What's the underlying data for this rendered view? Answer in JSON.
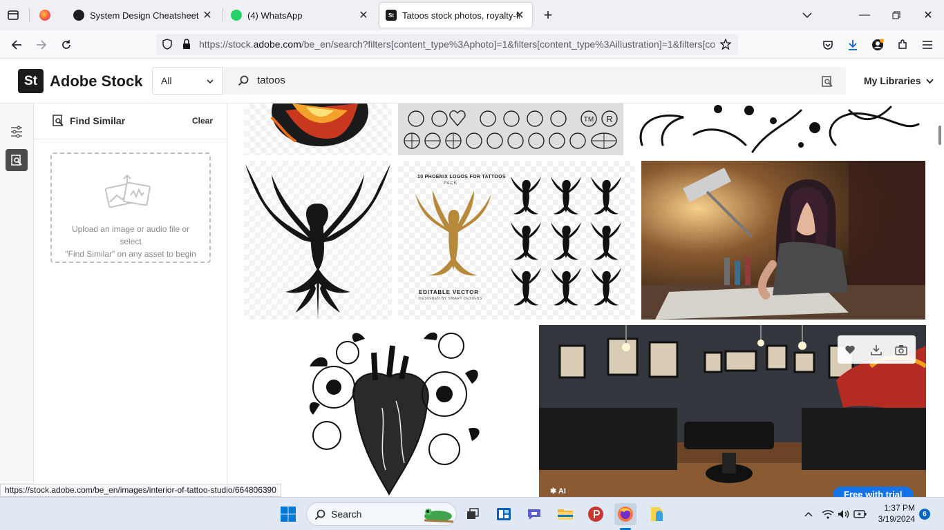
{
  "browser": {
    "tabs": [
      {
        "title": "",
        "favicon": "firefox-icon"
      },
      {
        "title": "System Design Cheatsheet",
        "favicon": "github-icon"
      },
      {
        "title": "(4) WhatsApp",
        "favicon": "whatsapp-icon"
      },
      {
        "title": "Tatoos stock photos, royalty-fre",
        "favicon": "adobe-stock-icon",
        "active": true
      }
    ],
    "url_prefix": "https://stock.",
    "url_domain": "adobe.com",
    "url_rest": "/be_en/search?filters[content_type%3Aphoto]=1&filters[content_type%3Aillustration]=1&filters[co",
    "status_url": "https://stock.adobe.com/be_en/images/interior-of-tattoo-studio/664806390"
  },
  "adobe": {
    "logo_mark": "St",
    "logo_text": "Adobe Stock",
    "filter_value": "All",
    "search_value": "tatoos",
    "my_libraries": "My Libraries"
  },
  "panel": {
    "title": "Find Similar",
    "clear": "Clear",
    "upload_line1": "Upload an image or audio file or select",
    "upload_line2": "\"Find Similar\" on any asset to begin"
  },
  "results": {
    "phoenix_pack_title": "10 PHOENIX LOGOS FOR TATTOOS",
    "phoenix_pack_sub": "PACK",
    "phoenix_pack_footer": "EDITABLE VECTOR",
    "phoenix_pack_credit": "DESIGNED BY SMART DESIGNS",
    "symbol_tm": "TM",
    "symbol_r": "R",
    "ai_badge": "AI",
    "free_trial": "Free with trial"
  },
  "taskbar": {
    "search_label": "Search",
    "time": "1:37 PM",
    "date": "3/19/2024",
    "notification_count": "6"
  },
  "colors": {
    "accent_blue": "#1473e6",
    "taskbar_bg": "#dfe8f3",
    "phoenix_gold": "#b68a3a"
  }
}
